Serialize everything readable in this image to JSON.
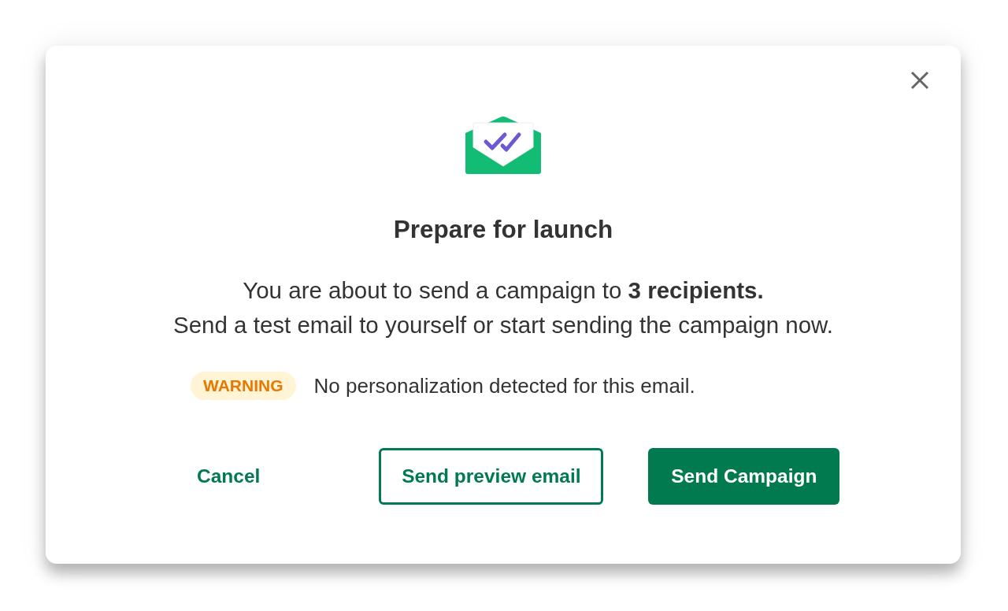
{
  "dialog": {
    "title": "Prepare for launch",
    "message": [
      "You are about to send a campaign to **3 recipients.**",
      "Send a test email to yourself or start sending the campaign now."
    ],
    "warning": {
      "badge": "WARNING",
      "text": "No personalization detected for this email."
    },
    "buttons": [
      {
        "label": "Cancel",
        "kind": "text"
      },
      {
        "label": "Send preview email",
        "kind": "outline"
      },
      {
        "label": "Send Campaign",
        "kind": "primary"
      }
    ]
  }
}
